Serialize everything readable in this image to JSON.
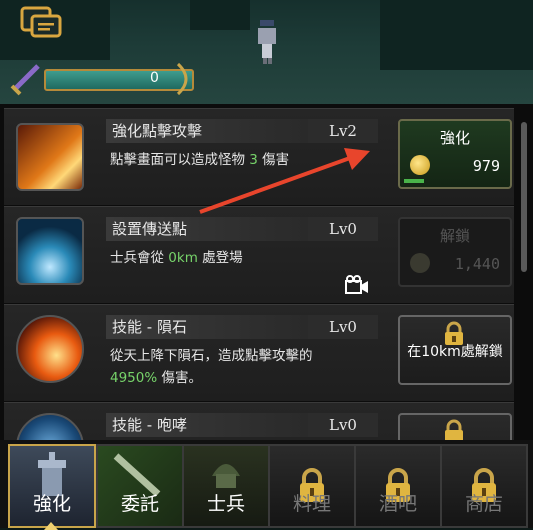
{
  "hud": {
    "score": "0"
  },
  "skills": [
    {
      "name": "強化點擊攻擊",
      "level": "Lv2",
      "desc_pre": "點擊畫面可以造成怪物 ",
      "desc_hl": "3",
      "desc_post": " 傷害",
      "button": "強化",
      "cost": "979",
      "state": "active"
    },
    {
      "name": "設置傳送點",
      "level": "Lv0",
      "desc_pre": "士兵會從 ",
      "desc_hl": "0km",
      "desc_post": " 處登場",
      "button": "解鎖",
      "cost": "1,440",
      "state": "disabled"
    },
    {
      "name": "技能 - 隕石",
      "level": "Lv0",
      "desc_line1": "從天上降下隕石，造成點擊攻擊的",
      "desc_hl": "4950%",
      "desc_post": " 傷害。",
      "button": "在10km處解鎖",
      "state": "locked"
    },
    {
      "name": "技能 - 咆哮",
      "level": "Lv0",
      "state": "locked"
    }
  ],
  "tabs": [
    {
      "label": "強化",
      "active": true,
      "locked": false
    },
    {
      "label": "委託",
      "active": false,
      "locked": false
    },
    {
      "label": "士兵",
      "active": false,
      "locked": false
    },
    {
      "label": "料理",
      "active": false,
      "locked": true
    },
    {
      "label": "酒吧",
      "active": false,
      "locked": true
    },
    {
      "label": "商店",
      "active": false,
      "locked": true
    }
  ],
  "colors": {
    "highlight": "#77d36a",
    "arrow": "#e8452c",
    "accent_gold": "#c9a54a"
  }
}
